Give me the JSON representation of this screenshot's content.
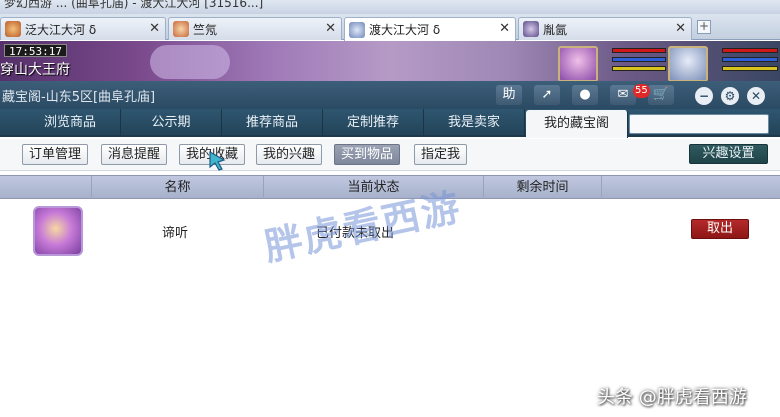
{
  "os_title": "梦幻西游 ... (曲阜孔庙) - 渡大江大河 [31516...]",
  "browser_tabs": [
    {
      "label": "泛大江大河 δ",
      "active": false
    },
    {
      "label": "竺氖",
      "active": false
    },
    {
      "label": "渡大江大河 δ",
      "active": true
    },
    {
      "label": "胤氤",
      "active": false
    }
  ],
  "scene": {
    "clock": "17:53:17",
    "location": "穿山大王府"
  },
  "window": {
    "title": "藏宝阁-山东5区[曲阜孔庙]",
    "help_label": "助",
    "badge_count": "55"
  },
  "nav_tabs": [
    "浏览商品",
    "公示期",
    "推荐商品",
    "定制推荐",
    "我是卖家",
    "我的藏宝阁"
  ],
  "nav_active": "我的藏宝阁",
  "sub_buttons": [
    "订单管理",
    "消息提醒",
    "我的收藏",
    "我的兴趣",
    "买到物品",
    "指定我"
  ],
  "sub_active": "买到物品",
  "interest_settings_label": "兴趣设置",
  "table": {
    "headers": [
      "名称",
      "当前状态",
      "剩余时间"
    ],
    "rows": [
      {
        "name": "谛听",
        "status": "已付款未取出",
        "remaining": "",
        "action": "取出"
      }
    ]
  },
  "watermarks": {
    "center": "胖虎看西游",
    "bottom": "头条 @胖虎看西游"
  },
  "colors": {
    "header_bg": "#2b4a63",
    "nav_active_bg": "#f4f6f8",
    "action_red": "#a11f1f",
    "settings_teal": "#1f4449"
  }
}
